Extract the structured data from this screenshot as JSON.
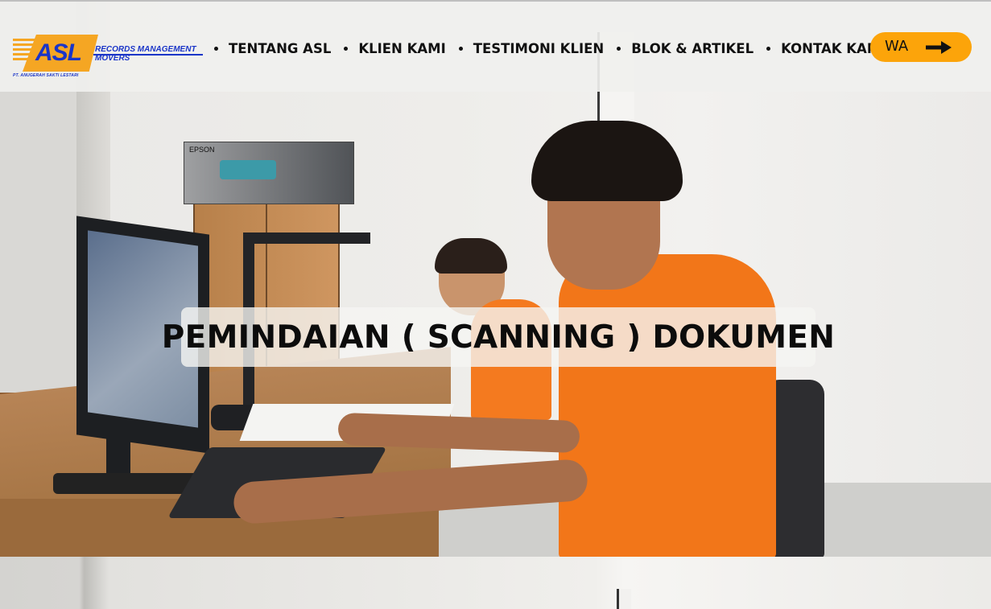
{
  "header": {
    "logo": {
      "mark": "ASL",
      "line1": "RECORDS MANAGEMENT",
      "line2": "MOVERS",
      "company": "PT. ANUGERAH SAKTI LESTARI"
    },
    "nav": [
      {
        "label": "TENTANG ASL"
      },
      {
        "label": "KLIEN KAMI"
      },
      {
        "label": "TESTIMONI KLIEN"
      },
      {
        "label": "BLOK & ARTIKEL"
      },
      {
        "label": "KONTAK KAMI"
      }
    ],
    "cta": {
      "label": "WA",
      "icon": "arrow-right-icon"
    }
  },
  "hero": {
    "title": "PEMINDAIAN ( SCANNING ) DOKUMEN",
    "printer_box_label": "EPSON"
  },
  "colors": {
    "brand_blue": "#1a35c8",
    "brand_orange": "#f5a623",
    "cta_orange": "#fca40a",
    "text_dark": "#111111"
  }
}
